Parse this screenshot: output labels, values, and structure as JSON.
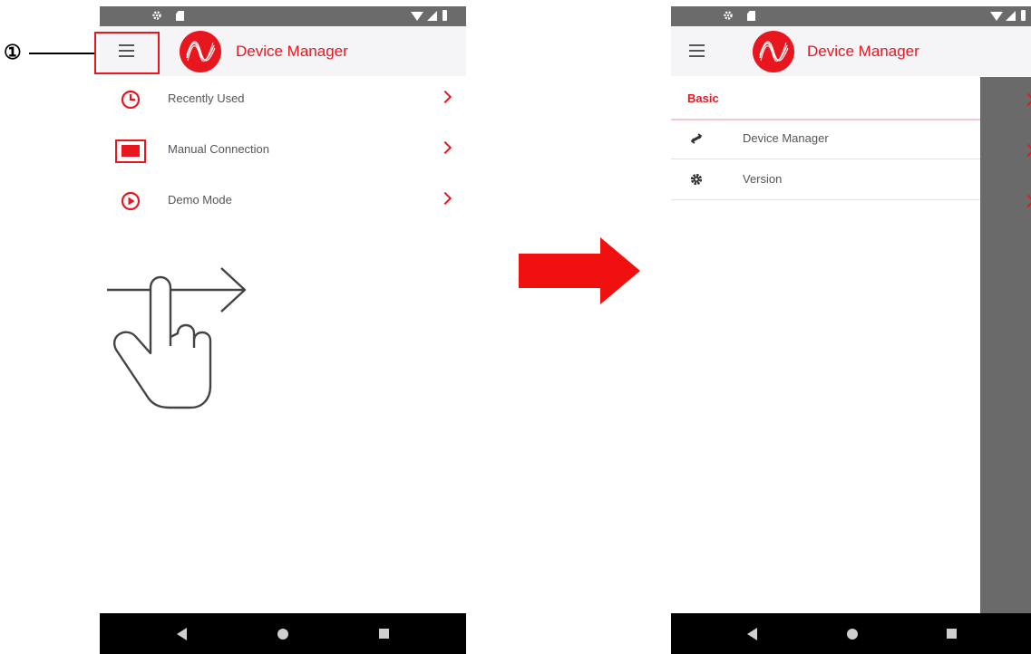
{
  "annotation": {
    "step_number": "①"
  },
  "left_screen": {
    "header": {
      "title": "Device Manager"
    },
    "menu": [
      {
        "label": "Recently Used",
        "icon": "recently-used-icon"
      },
      {
        "label": "Manual Connection",
        "icon": "ethernet-port-icon"
      },
      {
        "label": "Demo Mode",
        "icon": "play-circle-icon"
      }
    ]
  },
  "right_screen": {
    "header": {
      "title": "Device Manager"
    },
    "drawer": {
      "section": "Basic",
      "items": [
        {
          "label": "Device Manager",
          "icon": "transfer-arrows-icon"
        },
        {
          "label": "Version",
          "icon": "gear-icon"
        }
      ]
    }
  },
  "colors": {
    "accent": "#e8171f",
    "status_bar": "#6b6b6b",
    "scrim": "#6a6a6a",
    "nav_bar": "#000000"
  }
}
